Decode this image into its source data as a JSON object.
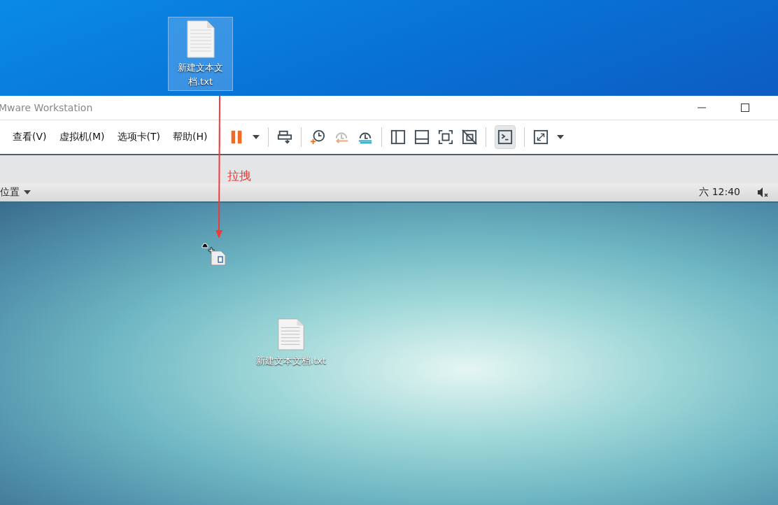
{
  "host_desktop": {
    "icon": {
      "label": "新建文本文档.txt",
      "selected": true
    }
  },
  "window": {
    "title": "Mware Workstation",
    "menu": [
      "查看(V)",
      "虚拟机(M)",
      "选项卡(T)",
      "帮助(H)"
    ],
    "console_view": {
      "selected": true
    }
  },
  "annotation": {
    "label": "拉拽"
  },
  "guest": {
    "top_bar": {
      "places": "位置",
      "clock": "六 12:40"
    },
    "desktop_icon": {
      "label": "新建文本文档.txt"
    }
  }
}
